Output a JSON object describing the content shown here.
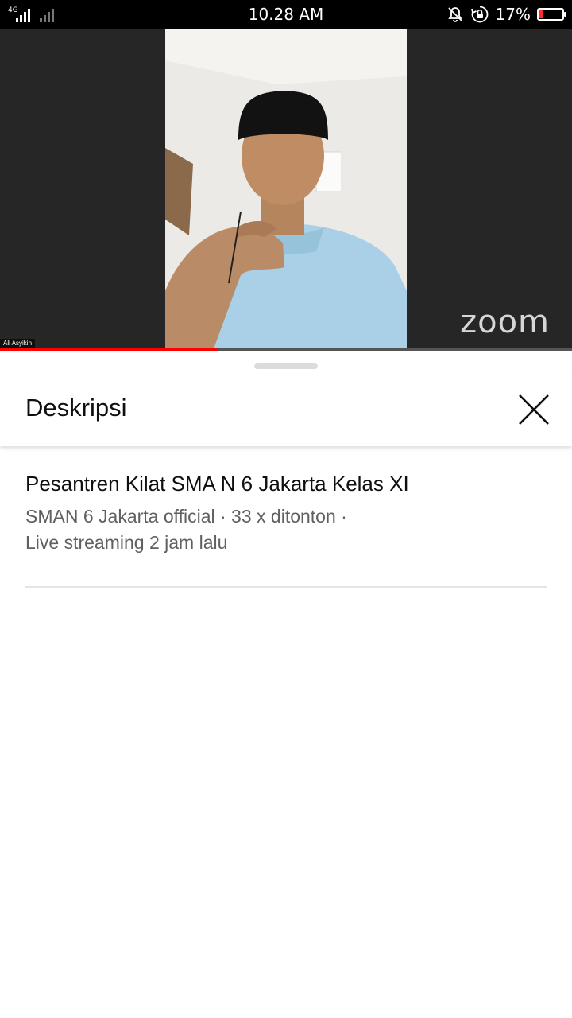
{
  "status_bar": {
    "network_type": "4G",
    "time": "10.28 AM",
    "battery_percent": "17%",
    "battery_level": 0.17,
    "icons": [
      "signal-icon",
      "no-signal-icon",
      "mute-icon",
      "rotation-lock-icon",
      "battery-icon"
    ]
  },
  "video": {
    "participant_name": "Ali Asyikin",
    "watermark": "zoom",
    "progress": 0.38,
    "progress_color": "#ff0000"
  },
  "description_sheet": {
    "title": "Deskripsi",
    "close_icon": "close-icon",
    "video_title": "Pesantren Kilat SMA N 6 Jakarta Kelas XI",
    "meta_line1": "SMAN 6 Jakarta official · 33 x ditonton ·",
    "meta_line2": "Live streaming 2 jam lalu"
  }
}
